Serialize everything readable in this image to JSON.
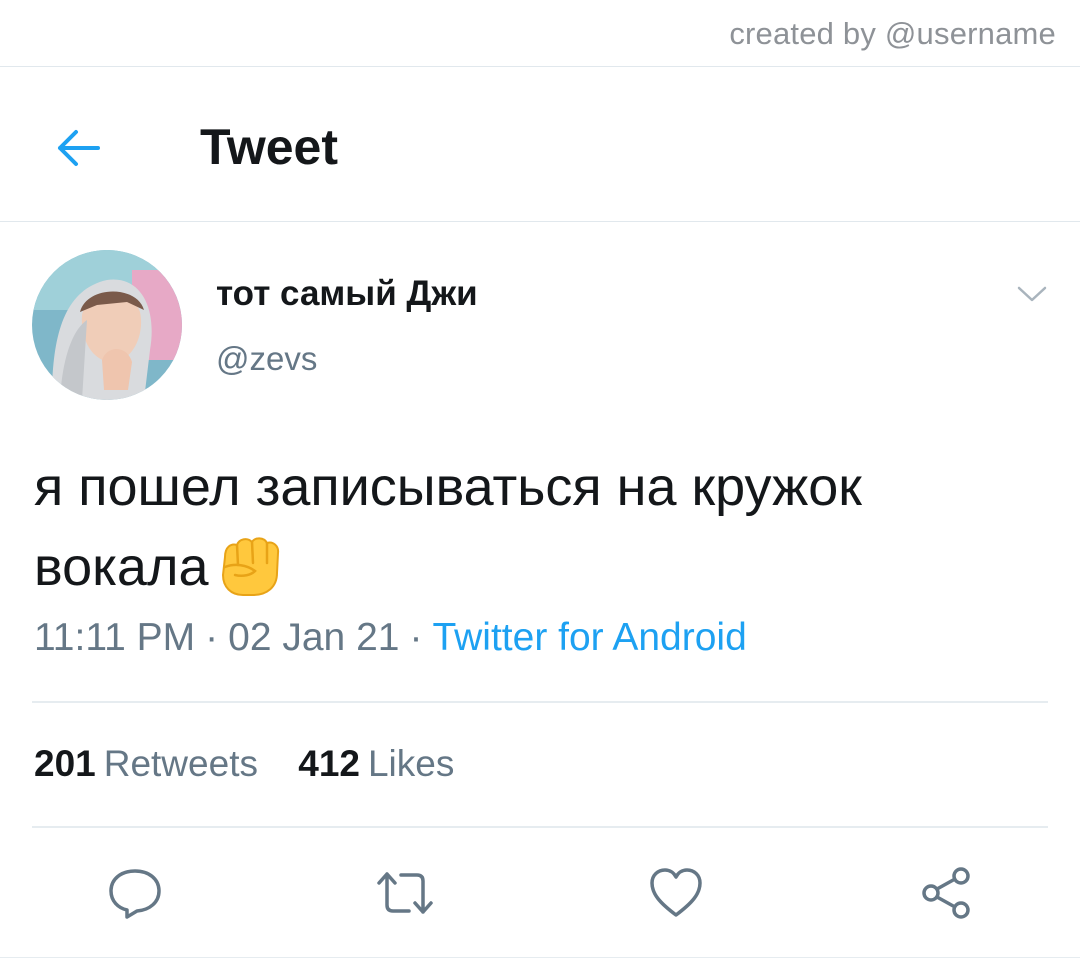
{
  "watermark": {
    "credit": "created by @username"
  },
  "header": {
    "title": "Tweet",
    "back_icon": "arrow-left-icon"
  },
  "author": {
    "name": "тот самый Джи",
    "handle": "@zevs",
    "menu_icon": "chevron-down-icon"
  },
  "tweet": {
    "text": "я пошел записываться на кружок вокала",
    "emoji": "raised-fist-emoji"
  },
  "meta": {
    "time": "11:11 PM",
    "separator": "·",
    "date": "02 Jan 21",
    "source": "Twitter for Android"
  },
  "stats": {
    "retweets_count": "201",
    "retweets_label": "Retweets",
    "likes_count": "412",
    "likes_label": "Likes"
  },
  "actions": {
    "reply_icon": "reply-icon",
    "retweet_icon": "retweet-icon",
    "like_icon": "heart-icon",
    "share_icon": "share-icon"
  },
  "colors": {
    "accent": "#1da1f2",
    "text": "#14171a",
    "secondary": "#657786",
    "divider": "#e6ecf0",
    "icon": "#657786"
  }
}
